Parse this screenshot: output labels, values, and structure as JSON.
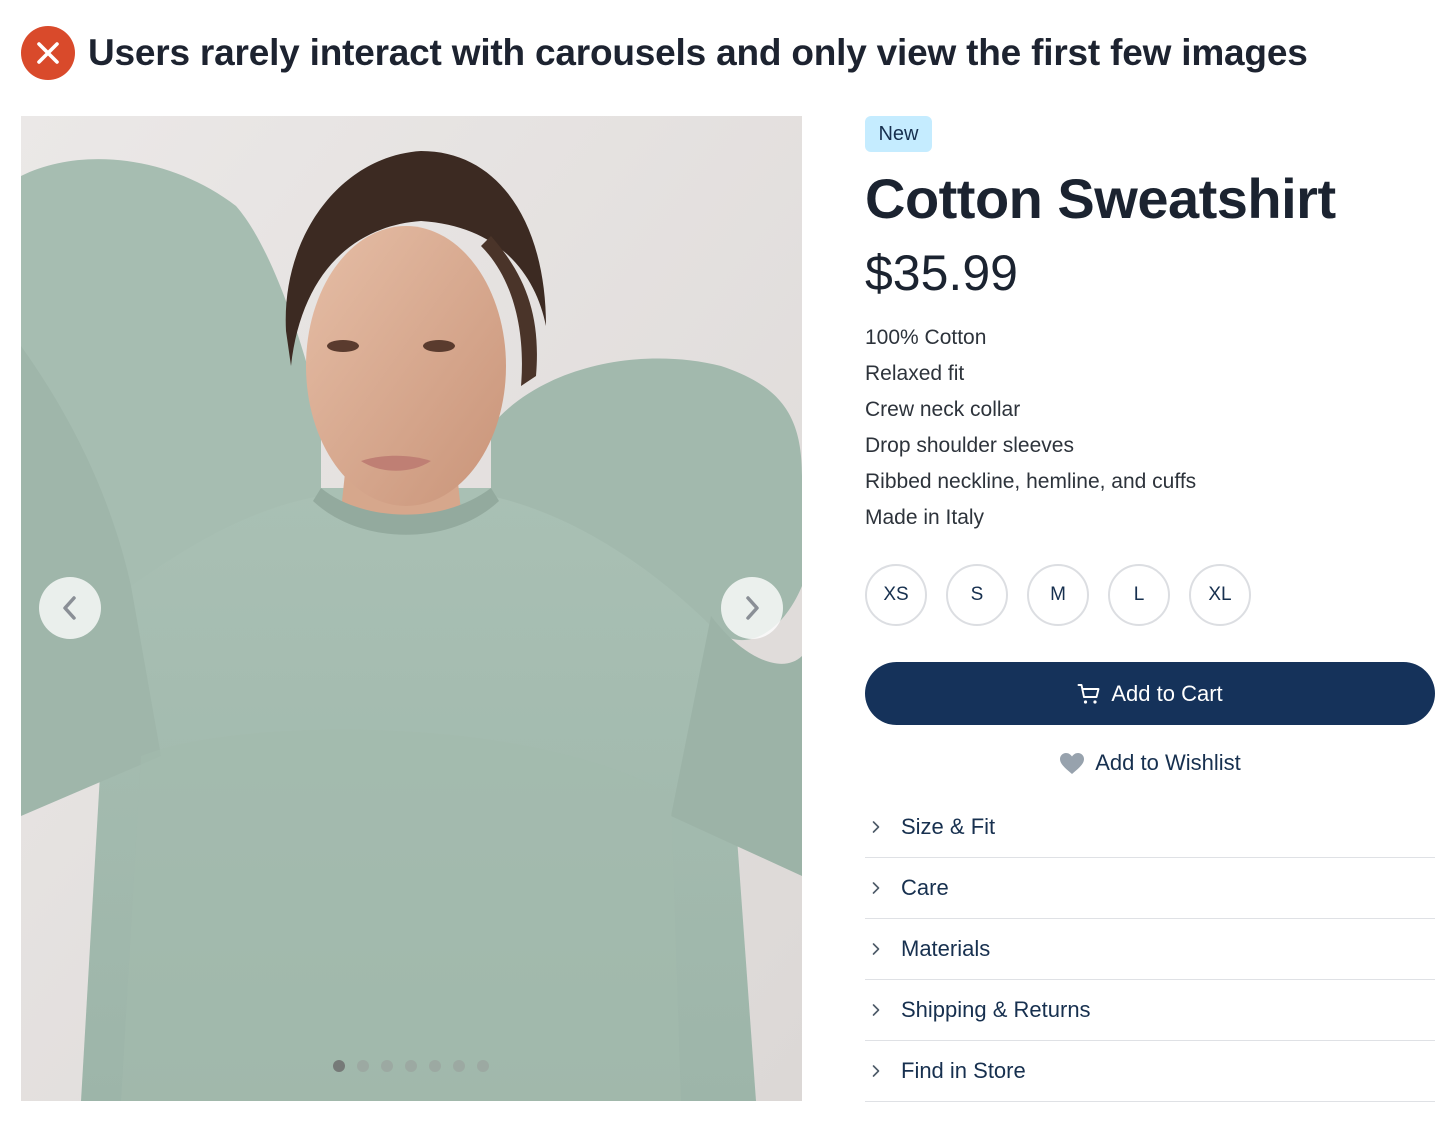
{
  "header": {
    "icon": "close-x-icon",
    "icon_color": "#d94a2b",
    "text": "Users rarely interact with carousels and only view the first few images"
  },
  "carousel": {
    "image": "woman-in-mint-sweatshirt-photo",
    "prev_icon": "chevron-left-icon",
    "next_icon": "chevron-right-icon",
    "dot_count": 7,
    "active_dot": 1
  },
  "product": {
    "badge": "New",
    "badge_color": "#c5ecff",
    "title": "Cotton Sweatshirt",
    "price": "$35.99",
    "features": [
      "100% Cotton",
      "Relaxed fit",
      "Crew neck collar",
      "Drop shoulder sleeves",
      "Ribbed neckline, hemline, and cuffs",
      "Made in Italy"
    ],
    "sizes": [
      "XS",
      "S",
      "M",
      "L",
      "XL"
    ],
    "add_to_cart": "Add to Cart",
    "cart_icon": "shopping-cart-icon",
    "cart_color": "#15325a",
    "add_to_wishlist": "Add to Wishlist",
    "wishlist_icon": "heart-icon",
    "accordion": [
      "Size & Fit",
      "Care",
      "Materials",
      "Shipping & Returns",
      "Find in Store"
    ]
  }
}
